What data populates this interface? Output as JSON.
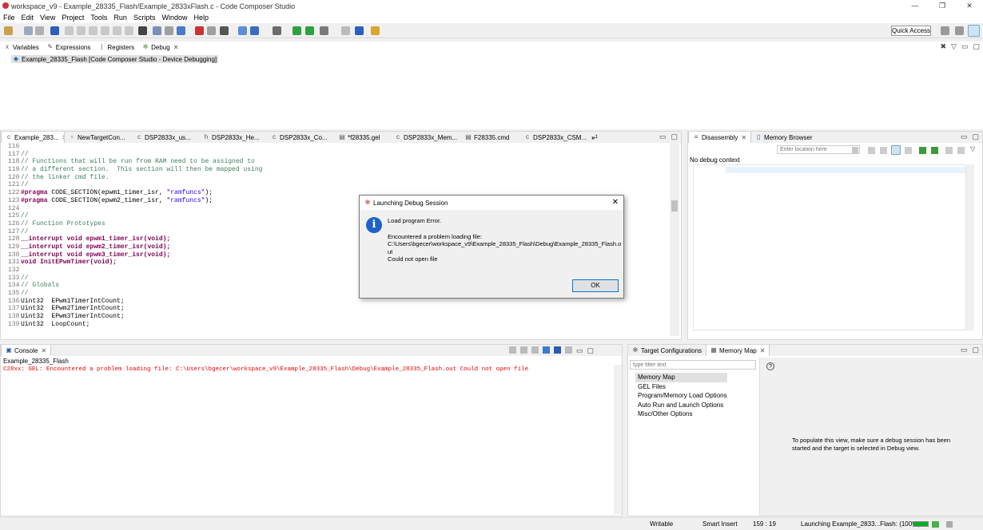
{
  "window": {
    "title": "workspace_v9 - Example_28335_Flash/Example_2833xFlash.c - Code Composer Studio",
    "minimize": "—",
    "maximize": "❐",
    "close": "✕"
  },
  "menu": [
    "File",
    "Edit",
    "View",
    "Project",
    "Tools",
    "Run",
    "Scripts",
    "Window",
    "Help"
  ],
  "toolbar": {
    "quick_access": "Quick Access"
  },
  "debug_view": {
    "tabs": [
      {
        "label": "Variables",
        "icon": "variables-icon"
      },
      {
        "label": "Expressions",
        "icon": "expressions-icon"
      },
      {
        "label": "Registers",
        "icon": "registers-icon"
      },
      {
        "label": "Debug",
        "icon": "debug-bug-icon"
      }
    ],
    "session": "Example_28335_Flash [Code Composer Studio - Device Debugging]"
  },
  "editor": {
    "tabs": [
      "Example_283...",
      "NewTargetCon...",
      "DSP2833x_us...",
      "DSP2833x_He...",
      "DSP2833x_Co...",
      "*f28335.gel",
      "DSP2833x_Mem...",
      "F28335.cmd",
      "DSP2833x_CSM..."
    ],
    "overflow": "»",
    "overflow_count": "1",
    "lines": [
      {
        "no": "116",
        "segs": []
      },
      {
        "no": "117",
        "segs": [
          {
            "t": "//",
            "c": "cm"
          }
        ]
      },
      {
        "no": "118",
        "segs": [
          {
            "t": "// Functions that will be run from RAM need to be assigned to",
            "c": "cm"
          }
        ]
      },
      {
        "no": "119",
        "segs": [
          {
            "t": "// a different section.  This section will then be mapped using",
            "c": "cm"
          }
        ]
      },
      {
        "no": "120",
        "segs": [
          {
            "t": "// the linker cmd file.",
            "c": "cm"
          }
        ]
      },
      {
        "no": "121",
        "segs": [
          {
            "t": "//",
            "c": "cm"
          }
        ]
      },
      {
        "no": "122",
        "segs": [
          {
            "t": "#pragma",
            "c": "kw"
          },
          {
            "t": " CODE_SECTION(epwm1_timer_isr, ",
            "c": ""
          },
          {
            "t": "\"ramfuncs\"",
            "c": "str"
          },
          {
            "t": ");",
            "c": ""
          }
        ]
      },
      {
        "no": "123",
        "segs": [
          {
            "t": "#pragma",
            "c": "kw"
          },
          {
            "t": " CODE_SECTION(epwm2_timer_isr, ",
            "c": ""
          },
          {
            "t": "\"ramfuncs\"",
            "c": "str"
          },
          {
            "t": ");",
            "c": ""
          }
        ]
      },
      {
        "no": "124",
        "segs": []
      },
      {
        "no": "125",
        "segs": [
          {
            "t": "//",
            "c": "cm"
          }
        ]
      },
      {
        "no": "126",
        "segs": [
          {
            "t": "// Function Prototypes",
            "c": "cm"
          }
        ]
      },
      {
        "no": "127",
        "segs": [
          {
            "t": "//",
            "c": "cm"
          }
        ]
      },
      {
        "no": "128",
        "segs": [
          {
            "t": "__interrupt void",
            "c": "kw"
          },
          {
            "t": " ",
            "c": ""
          },
          {
            "t": "epwm1_timer_isr",
            "c": "kw"
          },
          {
            "t": "(void);",
            "c": "kw"
          }
        ]
      },
      {
        "no": "129",
        "segs": [
          {
            "t": "__interrupt void",
            "c": "kw"
          },
          {
            "t": " ",
            "c": ""
          },
          {
            "t": "epwm2_timer_isr",
            "c": "kw"
          },
          {
            "t": "(void);",
            "c": "kw"
          }
        ]
      },
      {
        "no": "130",
        "segs": [
          {
            "t": "__interrupt void",
            "c": "kw"
          },
          {
            "t": " ",
            "c": ""
          },
          {
            "t": "epwm3_timer_isr",
            "c": "kw"
          },
          {
            "t": "(void);",
            "c": "kw"
          }
        ]
      },
      {
        "no": "131",
        "segs": [
          {
            "t": "void",
            "c": "kw"
          },
          {
            "t": " ",
            "c": ""
          },
          {
            "t": "InitEPwmTimer",
            "c": "kw"
          },
          {
            "t": "(void);",
            "c": "kw"
          }
        ]
      },
      {
        "no": "132",
        "segs": []
      },
      {
        "no": "133",
        "segs": [
          {
            "t": "//",
            "c": "cm"
          }
        ]
      },
      {
        "no": "134",
        "segs": [
          {
            "t": "// Globals",
            "c": "cm"
          }
        ]
      },
      {
        "no": "135",
        "segs": [
          {
            "t": "//",
            "c": "cm"
          }
        ]
      },
      {
        "no": "136",
        "segs": [
          {
            "t": "Uint32  EPwm1TimerIntCount;",
            "c": ""
          }
        ]
      },
      {
        "no": "137",
        "segs": [
          {
            "t": "Uint32  EPwm2TimerIntCount;",
            "c": ""
          }
        ]
      },
      {
        "no": "138",
        "segs": [
          {
            "t": "Uint32  EPwm3TimerIntCount;",
            "c": ""
          }
        ]
      },
      {
        "no": "139",
        "segs": [
          {
            "t": "Uint32  LoopCount;",
            "c": ""
          }
        ]
      }
    ]
  },
  "disassembly": {
    "tabs": [
      "Disassembly",
      "Memory Browser"
    ],
    "location_placeholder": "Enter location here",
    "empty": "No debug context"
  },
  "dialog": {
    "title": "Launching Debug Session",
    "line1": "Load program Error.",
    "line2": "Encountered a problem loading file:",
    "path": "C:\\Users\\bgecer\\workspace_v9\\Example_28335_Flash\\Debug\\Example_28335_Flash.o",
    "path_tail": "ut",
    "line3": "Could not open file",
    "ok": "OK"
  },
  "console": {
    "tab": "Console",
    "name": "Example_28335_Flash",
    "message": "C28xx: GEL: Encountered a problem loading file: C:\\Users\\bgecer\\workspace_v9\\Example_28335_Flash\\Debug\\Example_28335_Flash.out Could not open file"
  },
  "target_config": {
    "tabs": [
      "Target Configurations",
      "Memory Map"
    ],
    "filter_placeholder": "type filter text",
    "items": [
      "Memory Map",
      "GEL Files",
      "Program/Memory Load Options",
      "Auto Run and Launch Options",
      "Misc/Other Options"
    ],
    "help_glyph": "?",
    "hint": "To populate this view, make sure a debug session has been started and the target is selected in Debug view."
  },
  "status": {
    "writable": "Writable",
    "insert": "Smart Insert",
    "position": "159 : 19",
    "launch": "Launching Example_2833...Flash: (100%)"
  },
  "colors": {
    "accent": "#0078d7",
    "error": "#e00000",
    "progress": "#06b025"
  }
}
